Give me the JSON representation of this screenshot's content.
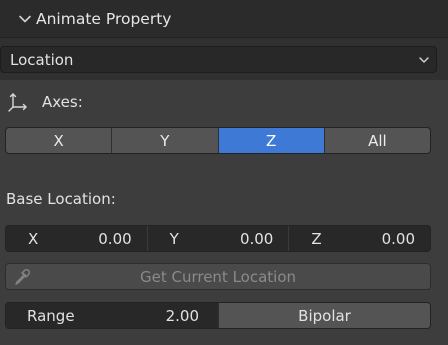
{
  "header": {
    "title": "Animate Property",
    "expand_icon": "chevron-down-icon"
  },
  "property_select": {
    "value": "Location",
    "icon": "chevron-down-icon"
  },
  "axes": {
    "label": "Axes:",
    "icon": "axes-icon",
    "options": [
      "X",
      "Y",
      "Z",
      "All"
    ],
    "selected": "Z"
  },
  "base_location": {
    "label": "Base Location:",
    "fields": [
      {
        "axis": "X",
        "value": "0.00"
      },
      {
        "axis": "Y",
        "value": "0.00"
      },
      {
        "axis": "Z",
        "value": "0.00"
      }
    ]
  },
  "get_current": {
    "label": "Get Current Location",
    "icon": "eyedropper-icon",
    "enabled": false
  },
  "range": {
    "label": "Range",
    "value": "2.00",
    "mode": "Bipolar"
  },
  "colors": {
    "accent": "#3f79d6",
    "panel": "#3d3d3d",
    "field": "#282828",
    "button": "#545454"
  }
}
